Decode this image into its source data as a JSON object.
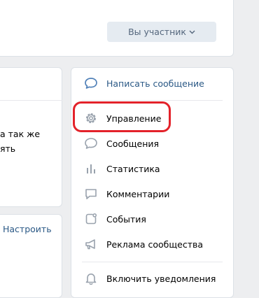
{
  "header": {
    "member_button_label": "Вы участник",
    "chevron_icon": "chevron-down-icon"
  },
  "left_panel": {
    "snippet_line_1": "а так же",
    "snippet_line_2": "ять",
    "settings_link": "Настроить"
  },
  "menu": {
    "items": [
      {
        "label": "Написать сообщение",
        "icon": "message-bubble-icon"
      },
      {
        "label": "Управление",
        "icon": "gear-icon"
      },
      {
        "label": "Сообщения",
        "icon": "chat-icon"
      },
      {
        "label": "Статистика",
        "icon": "bar-chart-icon"
      },
      {
        "label": "Комментарии",
        "icon": "comment-icon"
      },
      {
        "label": "События",
        "icon": "events-icon"
      },
      {
        "label": "Реклама сообщества",
        "icon": "megaphone-icon"
      },
      {
        "label": "Включить уведомления",
        "icon": "bell-icon"
      }
    ]
  },
  "colors": {
    "link": "#2a5885",
    "icon": "#99a2ad",
    "highlight": "#e3222a",
    "button_bg": "#e5ebf1"
  }
}
